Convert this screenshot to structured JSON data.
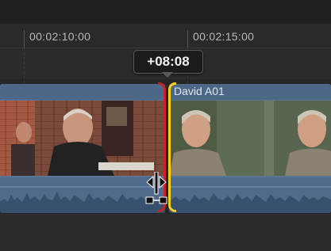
{
  "ruler": {
    "timecode_1": "00:02:10:00",
    "timecode_2": "00:02:15:00"
  },
  "trim_tooltip": {
    "value": "+08:08"
  },
  "clips": {
    "right_clip_name": "David A01"
  },
  "colors": {
    "clip_blue": "#5a7595",
    "selected_edge_yellow": "#f3d21c",
    "limit_edge_red": "#c8222a"
  },
  "icons": {
    "trim_cursor": "ripple-trim-cursor-icon"
  }
}
